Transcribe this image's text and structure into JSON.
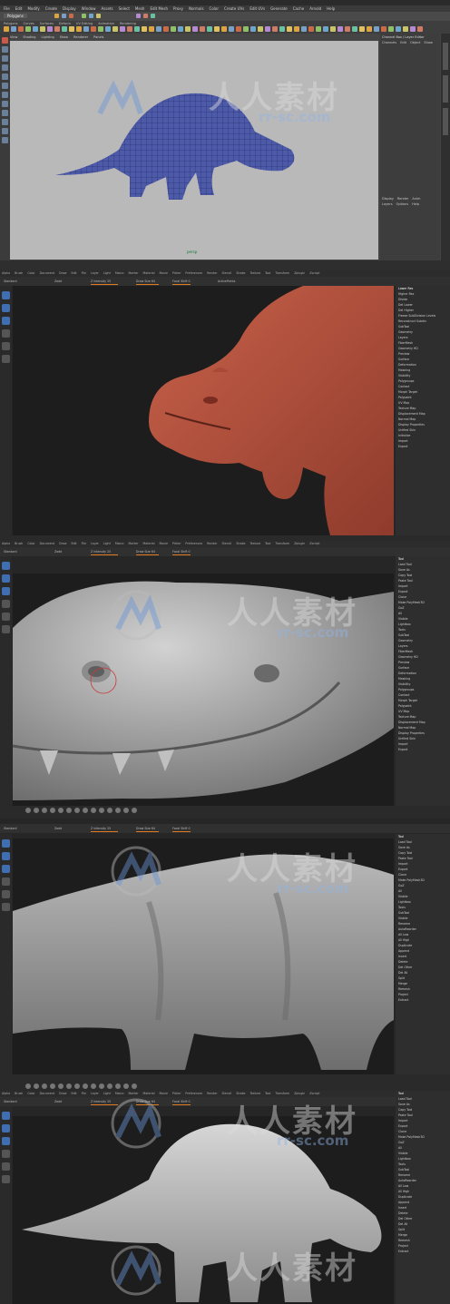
{
  "maya": {
    "menu": [
      "File",
      "Edit",
      "Modify",
      "Create",
      "Display",
      "Window",
      "Assets",
      "Select",
      "Mesh",
      "Edit Mesh",
      "Proxy",
      "Normals",
      "Color",
      "Create UVs",
      "Edit UVs",
      "Generate",
      "Cache",
      "Arnold",
      "Help"
    ],
    "mode": "Polygons",
    "shelf_tabs": [
      "Polygons",
      "Curves",
      "Surfaces",
      "Deform",
      "UV Editing",
      "Animation",
      "Rendering"
    ],
    "viewport_menu": [
      "View",
      "Shading",
      "Lighting",
      "Show",
      "Renderer",
      "Panels"
    ],
    "camera_label": "persp",
    "channel_box": {
      "header": "Channel Box / Layer Editor",
      "tabs": [
        "Channels",
        "Edit",
        "Object",
        "Show"
      ],
      "layer_tabs": [
        "Display",
        "Render",
        "Anim"
      ],
      "layer_menu": [
        "Layers",
        "Options",
        "Help"
      ]
    },
    "right_tabs": [
      "Attribute Editor",
      "Channel Box",
      "Tool Settings"
    ],
    "colors": {
      "accent": "#e07a1e",
      "viewport": "#b9b9b9"
    }
  },
  "zbrush": {
    "menu": [
      "Alpha",
      "Brush",
      "Color",
      "Document",
      "Draw",
      "Edit",
      "File",
      "Layer",
      "Light",
      "Macro",
      "Marker",
      "Material",
      "Movie",
      "Picker",
      "Preferences",
      "Render",
      "Stencil",
      "Stroke",
      "Texture",
      "Tool",
      "Transform",
      "Zplugin",
      "Zscript"
    ],
    "topbar": {
      "brush": "Standard",
      "mode": "Zadd",
      "z_intensity": "Z Intensity 25",
      "draw_size": "Draw Size 64",
      "focal_shift": "Focal Shift 0",
      "active_points": "ActivePoints",
      "total_points": "TotalPoints"
    },
    "screen1": {
      "status": "Tool: Inserted Tool",
      "subtool_panel": [
        "SubTool",
        "Geometry",
        "Layers",
        "FiberMesh",
        "Geometry HD",
        "Preview",
        "Surface",
        "Deformation",
        "Masking",
        "Visibility",
        "Polygroups",
        "Contact",
        "Morph Target",
        "Polypaint",
        "UV Map",
        "Texture Map",
        "Displacement Map",
        "Normal Map",
        "Display Properties",
        "Unified Skin",
        "Initialize",
        "Import",
        "Export"
      ],
      "buttons": [
        "Lower Res",
        "Higher Res",
        "Divide",
        "Del Lower",
        "Del Higher",
        "Freeze SubDivision Levels",
        "Reconstruct Subdiv"
      ]
    },
    "screen2_panel": [
      "Tool",
      "Load Tool",
      "Save As",
      "Copy Tool",
      "Paste Tool",
      "Import",
      "Export",
      "Clone",
      "Make PolyMesh3D",
      "GoZ",
      "All",
      "Visible",
      "Lightbox",
      "Tools",
      "SubTool",
      "Geometry",
      "Layers",
      "FiberMesh",
      "Geometry HD",
      "Preview",
      "Surface",
      "Deformation",
      "Masking",
      "Visibility",
      "Polygroups",
      "Contact",
      "Morph Target",
      "Polypaint",
      "UV Map",
      "Texture Map",
      "Displacement Map",
      "Normal Map",
      "Display Properties",
      "Unified Skin",
      "Import",
      "Export"
    ],
    "screen3_panel": [
      "Tool",
      "Load Tool",
      "Save As",
      "Copy Tool",
      "Paste Tool",
      "Import",
      "Export",
      "Clone",
      "Make PolyMesh3D",
      "GoZ",
      "All",
      "Visible",
      "Lightbox",
      "Tools",
      "SubTool",
      "Visible",
      "Rename",
      "AutoReorder",
      "All Low",
      "All High",
      "Duplicate",
      "Append",
      "Insert",
      "Delete",
      "Del Other",
      "Del All",
      "Split",
      "Merge",
      "Remesh",
      "Project",
      "Extract"
    ],
    "screen4_panel": [
      "Tool",
      "Load Tool",
      "Save As",
      "Copy Tool",
      "Paste Tool",
      "Import",
      "Export",
      "Clone",
      "Make PolyMesh3D",
      "GoZ",
      "All",
      "Visible",
      "Lightbox",
      "Tools",
      "SubTool",
      "Rename",
      "AutoReorder",
      "All Low",
      "All High",
      "Duplicate",
      "Append",
      "Insert",
      "Delete",
      "Del Other",
      "Del All",
      "Split",
      "Merge",
      "Remesh",
      "Project",
      "Extract"
    ]
  },
  "watermark": {
    "text_cn": "人人素材",
    "url": "rr-sc.com"
  }
}
